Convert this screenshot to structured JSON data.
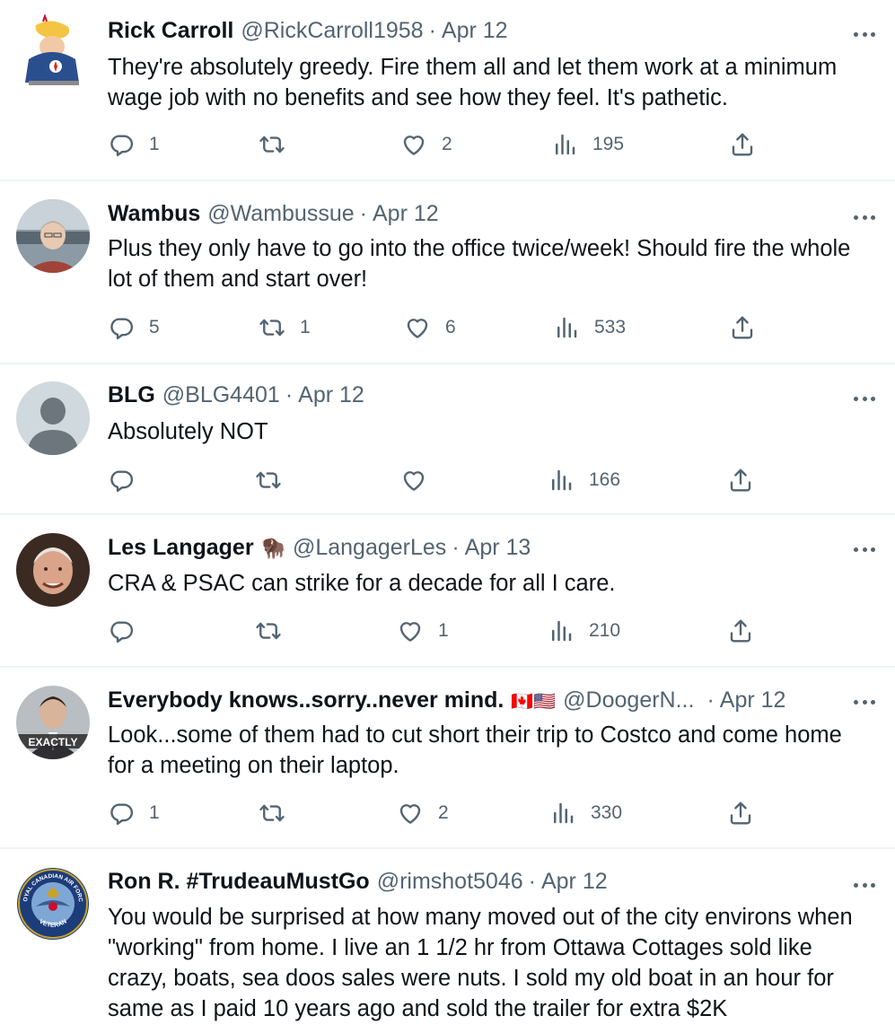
{
  "tweets": [
    {
      "display_name": "Rick Carroll",
      "handle": "@RickCarroll1958",
      "separator": "·",
      "date": "Apr 12",
      "text": "They're absolutely greedy. Fire them all and let them work at a minimum wage job with no benefits and see how they feel. It's pathetic.",
      "replies": "1",
      "retweets": "",
      "likes": "2",
      "views": "195",
      "avatar": "cartoon-avatar"
    },
    {
      "display_name": "Wambus",
      "handle": "@Wambussue",
      "separator": "·",
      "date": "Apr 12",
      "text": "Plus they only have to go into the office twice/week! Should fire the whole lot of them and start over!",
      "replies": "5",
      "retweets": "1",
      "likes": "6",
      "views": "533",
      "avatar": "photo-avatar"
    },
    {
      "display_name": "BLG",
      "handle": "@BLG4401",
      "separator": "·",
      "date": "Apr 12",
      "text": "Absolutely NOT",
      "replies": "",
      "retweets": "",
      "likes": "",
      "views": "166",
      "avatar": "default-avatar"
    },
    {
      "display_name": "Les Langager",
      "badge": "🦬",
      "handle": "@LangagerLes",
      "separator": "·",
      "date": "Apr 13",
      "text": "CRA & PSAC can strike for a decade for all I care.",
      "replies": "",
      "retweets": "",
      "likes": "1",
      "views": "210",
      "avatar": "photo-avatar"
    },
    {
      "display_name": "Everybody knows..sorry..never mind.",
      "badge": "🇨🇦🇺🇸",
      "handle": "@DoogerN...",
      "separator": "·",
      "date": "Apr 12",
      "text": "Look...some of them had to cut short their trip to Costco and come home for a meeting on their laptop.",
      "replies": "1",
      "retweets": "",
      "likes": "2",
      "views": "330",
      "avatar": "photo-avatar",
      "avatar_caption": "EXACTLY"
    },
    {
      "display_name": "Ron R. #TrudeauMustGo",
      "handle": "@rimshot5046",
      "separator": "·",
      "date": "Apr 12",
      "text": "You would be surprised at how many moved out of the city environs when \"working\" from home.  I live an 1 1/2 hr from Ottawa Cottages sold like crazy, boats, sea doos sales were nuts. I sold my old boat in an hour for same as I paid 10 years ago and sold the trailer for extra $2K",
      "avatar": "badge-avatar",
      "avatar_caption_top": "ROYAL CANADIAN AIR FORCE",
      "avatar_caption_bottom": "VETERAN"
    }
  ],
  "colors": {
    "text": "#0f1419",
    "muted": "#536471",
    "border": "#eff3f4"
  }
}
